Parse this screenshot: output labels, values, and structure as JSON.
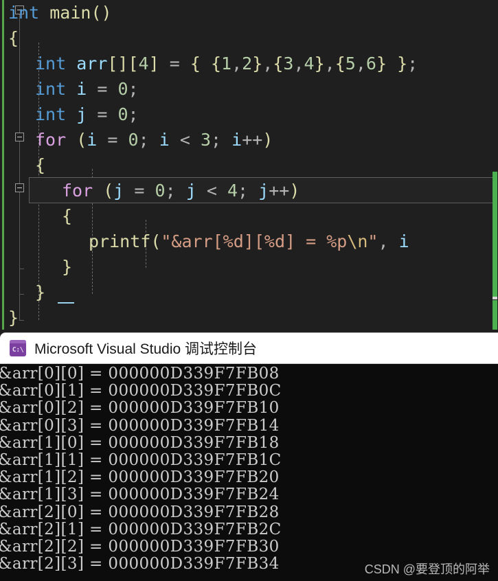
{
  "editor": {
    "theme_background": "#1f1f1f",
    "change_marker_color": "#57a64a",
    "lines": [
      {
        "indent": 0,
        "tokens": [
          {
            "t": "int",
            "c": "t-key"
          },
          {
            "t": " ",
            "c": "t-plain"
          },
          {
            "t": "main",
            "c": "t-fn"
          },
          {
            "t": "()",
            "c": "t-punct"
          }
        ]
      },
      {
        "indent": 0,
        "tokens": [
          {
            "t": "{",
            "c": "t-punct"
          }
        ]
      },
      {
        "indent": 1,
        "tokens": [
          {
            "t": "int",
            "c": "t-key"
          },
          {
            "t": " ",
            "c": "t-plain"
          },
          {
            "t": "arr",
            "c": "t-var"
          },
          {
            "t": "[]",
            "c": "t-punct"
          },
          {
            "t": "[",
            "c": "t-punct"
          },
          {
            "t": "4",
            "c": "t-num"
          },
          {
            "t": "]",
            "c": "t-punct"
          },
          {
            "t": " ",
            "c": "t-plain"
          },
          {
            "t": "=",
            "c": "t-op"
          },
          {
            "t": " ",
            "c": "t-plain"
          },
          {
            "t": "{",
            "c": "t-punct"
          },
          {
            "t": " ",
            "c": "t-plain"
          },
          {
            "t": "{",
            "c": "t-punct"
          },
          {
            "t": "1",
            "c": "t-num"
          },
          {
            "t": ",",
            "c": "t-op"
          },
          {
            "t": "2",
            "c": "t-num"
          },
          {
            "t": "}",
            "c": "t-punct"
          },
          {
            "t": ",",
            "c": "t-op"
          },
          {
            "t": "{",
            "c": "t-punct"
          },
          {
            "t": "3",
            "c": "t-num"
          },
          {
            "t": ",",
            "c": "t-op"
          },
          {
            "t": "4",
            "c": "t-num"
          },
          {
            "t": "}",
            "c": "t-punct"
          },
          {
            "t": ",",
            "c": "t-op"
          },
          {
            "t": "{",
            "c": "t-punct"
          },
          {
            "t": "5",
            "c": "t-num"
          },
          {
            "t": ",",
            "c": "t-op"
          },
          {
            "t": "6",
            "c": "t-num"
          },
          {
            "t": "}",
            "c": "t-punct"
          },
          {
            "t": " ",
            "c": "t-plain"
          },
          {
            "t": "}",
            "c": "t-punct"
          },
          {
            "t": ";",
            "c": "t-op"
          }
        ]
      },
      {
        "indent": 1,
        "tokens": [
          {
            "t": "int",
            "c": "t-key"
          },
          {
            "t": " ",
            "c": "t-plain"
          },
          {
            "t": "i",
            "c": "t-var"
          },
          {
            "t": " ",
            "c": "t-plain"
          },
          {
            "t": "=",
            "c": "t-op"
          },
          {
            "t": " ",
            "c": "t-plain"
          },
          {
            "t": "0",
            "c": "t-num"
          },
          {
            "t": ";",
            "c": "t-op"
          }
        ]
      },
      {
        "indent": 1,
        "tokens": [
          {
            "t": "int",
            "c": "t-key"
          },
          {
            "t": " ",
            "c": "t-plain"
          },
          {
            "t": "j",
            "c": "t-var"
          },
          {
            "t": " ",
            "c": "t-plain"
          },
          {
            "t": "=",
            "c": "t-op"
          },
          {
            "t": " ",
            "c": "t-plain"
          },
          {
            "t": "0",
            "c": "t-num"
          },
          {
            "t": ";",
            "c": "t-op"
          }
        ]
      },
      {
        "indent": 1,
        "tokens": [
          {
            "t": "for",
            "c": "t-ctrl"
          },
          {
            "t": " ",
            "c": "t-plain"
          },
          {
            "t": "(",
            "c": "t-punct"
          },
          {
            "t": "i",
            "c": "t-var"
          },
          {
            "t": " ",
            "c": "t-plain"
          },
          {
            "t": "=",
            "c": "t-op"
          },
          {
            "t": " ",
            "c": "t-plain"
          },
          {
            "t": "0",
            "c": "t-num"
          },
          {
            "t": ";",
            "c": "t-op"
          },
          {
            "t": " ",
            "c": "t-plain"
          },
          {
            "t": "i",
            "c": "t-var"
          },
          {
            "t": " ",
            "c": "t-plain"
          },
          {
            "t": "<",
            "c": "t-op"
          },
          {
            "t": " ",
            "c": "t-plain"
          },
          {
            "t": "3",
            "c": "t-num"
          },
          {
            "t": ";",
            "c": "t-op"
          },
          {
            "t": " ",
            "c": "t-plain"
          },
          {
            "t": "i",
            "c": "t-var"
          },
          {
            "t": "++",
            "c": "t-op"
          },
          {
            "t": ")",
            "c": "t-punct"
          }
        ]
      },
      {
        "indent": 1,
        "tokens": [
          {
            "t": "{",
            "c": "t-punct"
          }
        ]
      },
      {
        "indent": 2,
        "tokens": [
          {
            "t": "for",
            "c": "t-ctrl"
          },
          {
            "t": " ",
            "c": "t-plain"
          },
          {
            "t": "(",
            "c": "t-punct"
          },
          {
            "t": "j",
            "c": "t-var"
          },
          {
            "t": " ",
            "c": "t-plain"
          },
          {
            "t": "=",
            "c": "t-op"
          },
          {
            "t": " ",
            "c": "t-plain"
          },
          {
            "t": "0",
            "c": "t-num"
          },
          {
            "t": ";",
            "c": "t-op"
          },
          {
            "t": " ",
            "c": "t-plain"
          },
          {
            "t": "j",
            "c": "t-var"
          },
          {
            "t": " ",
            "c": "t-plain"
          },
          {
            "t": "<",
            "c": "t-op"
          },
          {
            "t": " ",
            "c": "t-plain"
          },
          {
            "t": "4",
            "c": "t-num"
          },
          {
            "t": ";",
            "c": "t-op"
          },
          {
            "t": " ",
            "c": "t-plain"
          },
          {
            "t": "j",
            "c": "t-var"
          },
          {
            "t": "++",
            "c": "t-op"
          },
          {
            "t": ")",
            "c": "t-punct"
          }
        ]
      },
      {
        "indent": 2,
        "tokens": [
          {
            "t": "{",
            "c": "t-punct"
          }
        ]
      },
      {
        "indent": 3,
        "tokens": [
          {
            "t": "printf",
            "c": "t-fn"
          },
          {
            "t": "(",
            "c": "t-punct"
          },
          {
            "t": "\"&arr[%d][%d] = %p",
            "c": "t-str"
          },
          {
            "t": "\\n",
            "c": "t-esc"
          },
          {
            "t": "\"",
            "c": "t-str"
          },
          {
            "t": ",",
            "c": "t-op"
          },
          {
            "t": " ",
            "c": "t-plain"
          },
          {
            "t": "i",
            "c": "t-var"
          }
        ]
      },
      {
        "indent": 2,
        "tokens": [
          {
            "t": "}",
            "c": "t-punct"
          }
        ]
      },
      {
        "indent": 1,
        "tokens": [
          {
            "t": "}",
            "c": "t-punct"
          }
        ]
      },
      {
        "indent": 0,
        "tokens": [
          {
            "t": "}",
            "c": "t-punct"
          }
        ]
      }
    ],
    "source_text": "int main()\n{\n    int arr[][4] = { {1,2},{3,4},{5,6} };\n    int i = 0;\n    int j = 0;\n    for (i = 0; i < 3; i++)\n    {\n        for (j = 0; j < 4; j++)\n        {\n            printf(\"&arr[%d][%d] = %p\\n\", i\n        }\n    }\n}",
    "highlighted_line_index": 7,
    "collapse_markers": [
      0,
      5,
      7
    ]
  },
  "console": {
    "title": "Microsoft Visual Studio 调试控制台",
    "icon": "console-cmd-icon",
    "icon_label": "C:\\",
    "background": "#0c0c0c",
    "titlebar_background": "#ffffff",
    "output_lines": [
      "&arr[0][0] = 000000D339F7FB08",
      "&arr[0][1] = 000000D339F7FB0C",
      "&arr[0][2] = 000000D339F7FB10",
      "&arr[0][3] = 000000D339F7FB14",
      "&arr[1][0] = 000000D339F7FB18",
      "&arr[1][1] = 000000D339F7FB1C",
      "&arr[1][2] = 000000D339F7FB20",
      "&arr[1][3] = 000000D339F7FB24",
      "&arr[2][0] = 000000D339F7FB28",
      "&arr[2][1] = 000000D339F7FB2C",
      "&arr[2][2] = 000000D339F7FB30",
      "&arr[2][3] = 000000D339F7FB34"
    ]
  },
  "watermark": {
    "text": "CSDN @要登顶的阿举"
  }
}
